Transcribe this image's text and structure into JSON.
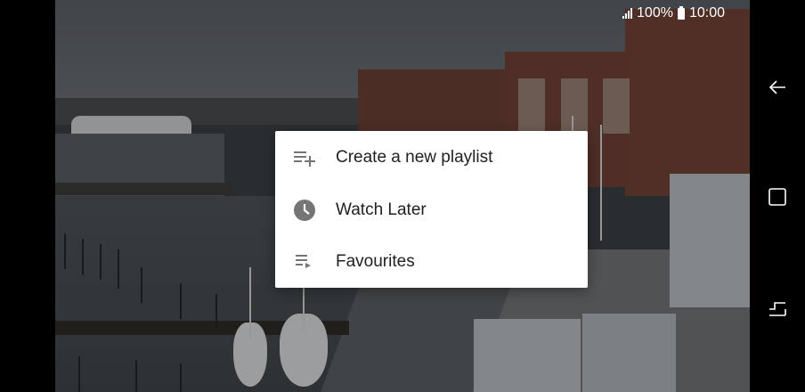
{
  "status_bar": {
    "battery": "100%",
    "time": "10:00"
  },
  "menu": {
    "items": [
      {
        "label": "Create a new playlist",
        "icon": "playlist-add-icon"
      },
      {
        "label": "Watch Later",
        "icon": "clock-icon"
      },
      {
        "label": "Favourites",
        "icon": "playlist-play-icon"
      }
    ]
  },
  "nav": {
    "back": "back-icon",
    "home": "home-icon",
    "recents": "recents-icon"
  }
}
